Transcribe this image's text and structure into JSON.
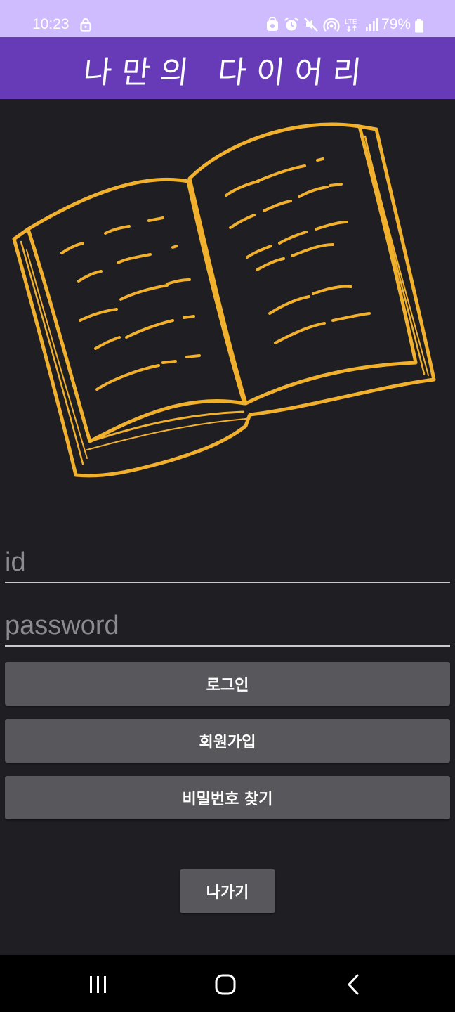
{
  "status_bar": {
    "time": "10:23",
    "battery": "79%",
    "network": "LTE",
    "background_color": "#cfbcff",
    "icons": [
      "lock-icon",
      "app-notification-icon",
      "alarm-icon",
      "mute-icon",
      "hotspot-icon",
      "lte-icon",
      "signal-icon",
      "battery-icon"
    ]
  },
  "app_bar": {
    "title": "나만의 다이어리",
    "background_color": "#673ab7"
  },
  "illustration": {
    "name": "open-book-icon",
    "stroke_color": "#f2b12d"
  },
  "login_form": {
    "id_placeholder": "id",
    "password_placeholder": "password",
    "login_label": "로그인",
    "signup_label": "회원가입",
    "find_password_label": "비밀번호 찾기",
    "exit_label": "나가기",
    "button_color": "#58575b"
  },
  "nav_bar": {
    "icons": [
      "recents-icon",
      "home-icon",
      "back-icon"
    ]
  }
}
